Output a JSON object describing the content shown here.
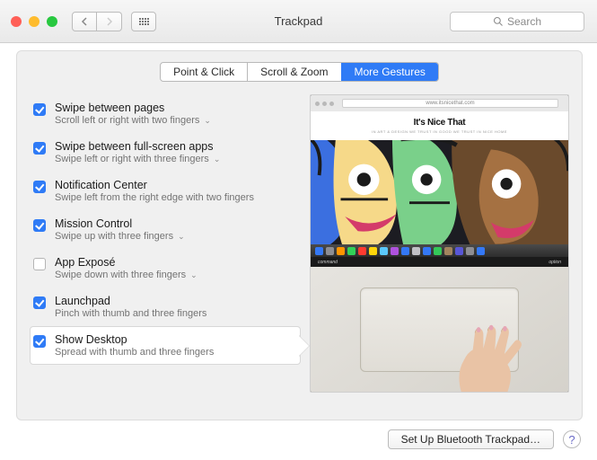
{
  "window": {
    "title": "Trackpad"
  },
  "search": {
    "placeholder": "Search"
  },
  "tabs": {
    "items": [
      {
        "label": "Point & Click",
        "active": false
      },
      {
        "label": "Scroll & Zoom",
        "active": false
      },
      {
        "label": "More Gestures",
        "active": true
      }
    ]
  },
  "options": [
    {
      "label": "Swipe between pages",
      "desc": "Scroll left or right with two fingers",
      "checked": true,
      "dropdown": true
    },
    {
      "label": "Swipe between full-screen apps",
      "desc": "Swipe left or right with three fingers",
      "checked": true,
      "dropdown": true
    },
    {
      "label": "Notification Center",
      "desc": "Swipe left from the right edge with two fingers",
      "checked": true,
      "dropdown": false
    },
    {
      "label": "Mission Control",
      "desc": "Swipe up with three fingers",
      "checked": true,
      "dropdown": true
    },
    {
      "label": "App Exposé",
      "desc": "Swipe down with three fingers",
      "checked": false,
      "dropdown": true
    },
    {
      "label": "Launchpad",
      "desc": "Pinch with thumb and three fingers",
      "checked": true,
      "dropdown": false
    },
    {
      "label": "Show Desktop",
      "desc": "Spread with thumb and three fingers",
      "checked": true,
      "dropdown": false,
      "selected": true
    }
  ],
  "preview": {
    "page_title": "It's Nice That",
    "page_sub": "IN ART & DESIGN WE TRUST IN GOOD WE TRUST IN NICE HOME",
    "url": "www.itsnicethat.com",
    "keys_left": "command",
    "keys_right": "option"
  },
  "bottom": {
    "button": "Set Up Bluetooth Trackpad…"
  },
  "colors": {
    "accent": "#2f7bf6"
  }
}
